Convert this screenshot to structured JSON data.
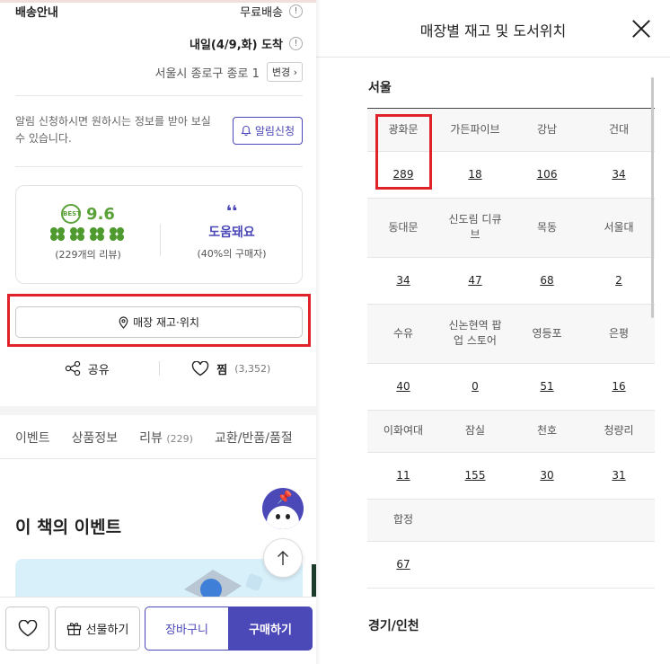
{
  "left": {
    "shipping": {
      "label": "배송안내",
      "free": "무료배송",
      "arrival": "내일(4/9,화) 도착",
      "address": "서울시 종로구 종로 1",
      "change_label": "변경 ›"
    },
    "notify": {
      "text": "알림 신청하시면 원하시는 정보를 받아 보실 수 있습니다.",
      "button": "알림신청"
    },
    "review": {
      "score": "9.6",
      "count": "(229개의 리뷰)",
      "helpful": "도움돼요",
      "helpful_pct": "(40%의 구매자)",
      "badge": "BEST"
    },
    "store_button": "매장 재고·위치",
    "share": "공유",
    "wish": {
      "label": "찜",
      "count": "(3,352)"
    },
    "tabs": [
      {
        "label": "이벤트",
        "count": ""
      },
      {
        "label": "상품정보",
        "count": ""
      },
      {
        "label": "리뷰",
        "count": "(229)"
      },
      {
        "label": "교환/반품/품절",
        "count": ""
      }
    ],
    "event_title": "이 책의 이벤트",
    "bottom": {
      "gift": "선물하기",
      "cart": "장바구니",
      "buy": "구매하기"
    }
  },
  "panel": {
    "title": "매장별 재고 및 도서위치",
    "regions": [
      {
        "name": "서울",
        "stores": [
          {
            "name": "광화문",
            "count": "289"
          },
          {
            "name": "가든파이브",
            "count": "18"
          },
          {
            "name": "강남",
            "count": "106"
          },
          {
            "name": "건대",
            "count": "34"
          },
          {
            "name": "동대문",
            "count": "34"
          },
          {
            "name": "신도림 디큐브",
            "count": "47"
          },
          {
            "name": "목동",
            "count": "68"
          },
          {
            "name": "서울대",
            "count": "2"
          },
          {
            "name": "수유",
            "count": "40"
          },
          {
            "name": "신논현역 팝업 스토어",
            "count": "0"
          },
          {
            "name": "영등포",
            "count": "51"
          },
          {
            "name": "은평",
            "count": "16"
          },
          {
            "name": "이화여대",
            "count": "11"
          },
          {
            "name": "잠실",
            "count": "155"
          },
          {
            "name": "천호",
            "count": "30"
          },
          {
            "name": "청량리",
            "count": "31"
          },
          {
            "name": "합정",
            "count": "67"
          }
        ]
      },
      {
        "name": "경기/인천"
      }
    ]
  },
  "colors": {
    "accent": "#4b48b8",
    "highlight": "#e0222b",
    "rating": "#5aa13a"
  }
}
